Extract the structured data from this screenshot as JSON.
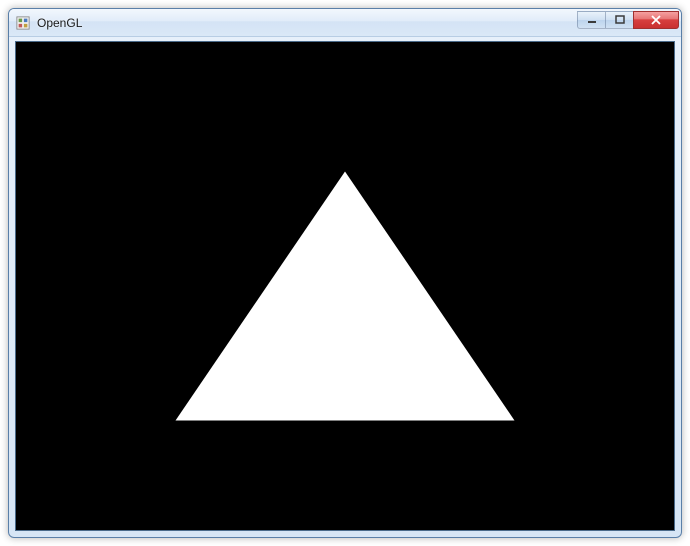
{
  "window": {
    "title": "OpenGL",
    "icon_name": "opengl-app-icon"
  },
  "controls": {
    "minimize_label": "Minimize",
    "maximize_label": "Maximize",
    "close_label": "Close"
  },
  "canvas": {
    "background_color": "#000000",
    "shape": "triangle",
    "shape_color": "#ffffff"
  }
}
